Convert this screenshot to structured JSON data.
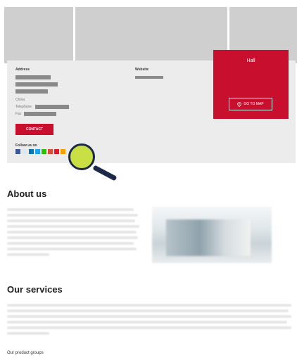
{
  "card": {
    "address_label": "Address",
    "website_label": "Website",
    "country": "China",
    "telephone_label": "Telephone",
    "fax_label": "Fax",
    "contact_button": "CONTACT",
    "follow_label": "Follow us on"
  },
  "hall": {
    "title": "Hall",
    "go_to_map": "GO TO MAP"
  },
  "about": {
    "heading": "About us"
  },
  "services": {
    "heading": "Our services"
  },
  "product_groups": "Our product groups",
  "colors": {
    "accent_red": "#c8102e",
    "magnifier_lens": "#c9df44",
    "magnifier_frame": "#1c2a4a"
  },
  "icons": [
    "facebook-icon",
    "xing-icon",
    "linkedin-icon",
    "twitter-icon",
    "wechat-icon",
    "googleplus-icon",
    "weibo-icon",
    "map-pin-icon",
    "magnifier-icon"
  ]
}
